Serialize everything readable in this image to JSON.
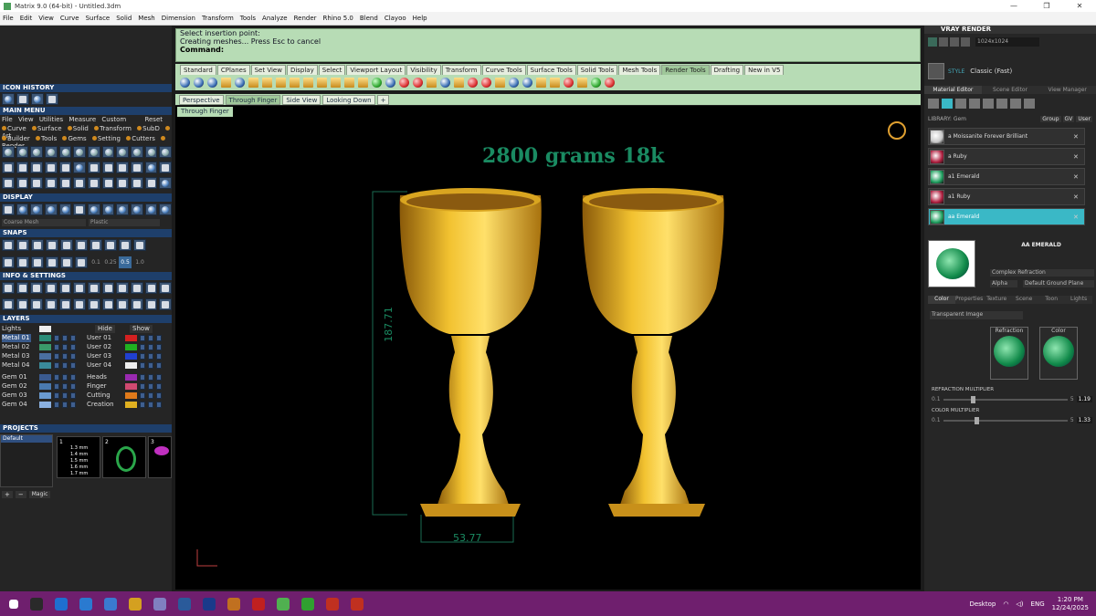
{
  "window": {
    "title": "Matrix 9.0 (64-bit) - Untitled.3dm",
    "minimize": "—",
    "maximize": "❐",
    "close": "✕"
  },
  "menubar": [
    "File",
    "Edit",
    "View",
    "Curve",
    "Surface",
    "Solid",
    "Mesh",
    "Dimension",
    "Transform",
    "Tools",
    "Analyze",
    "Render",
    "Rhino 5.0",
    "Blend",
    "Clayoo",
    "Help"
  ],
  "command": {
    "line1": "Select insertion point:",
    "line2": "Creating meshes... Press Esc to cancel",
    "prompt": "Command:"
  },
  "toolbar_tabs": [
    "Standard",
    "CPlanes",
    "Set View",
    "Display",
    "Select",
    "Viewport Layout",
    "Visibility",
    "Transform",
    "Curve Tools",
    "Surface Tools",
    "Solid Tools",
    "Mesh Tools",
    "Render Tools",
    "Drafting",
    "New in V5"
  ],
  "viewport_tabs": [
    "Perspective",
    "Through Finger",
    "Side View",
    "Looking Down",
    "+"
  ],
  "viewport_label": "Through Finger",
  "viewport": {
    "title": "2800 grams 18k",
    "dim_vertical": "187.71",
    "dim_horizontal": "53.77"
  },
  "left": {
    "icon_history": "ICON HISTORY",
    "main_menu": "MAIN MENU",
    "main_menu_row1": [
      "File",
      "View",
      "Utilities",
      "Measure",
      "Custom",
      "Reset"
    ],
    "main_menu_row2": [
      "Curve",
      "Surface",
      "Solid",
      "Transform",
      "SubD",
      "Art"
    ],
    "main_menu_row3": [
      "Builder",
      "Tools",
      "Gems",
      "Setting",
      "Cutters",
      "Render"
    ],
    "display": "DISPLAY",
    "display_modes": [
      "Coarse Mesh",
      "Plastic"
    ],
    "snaps": "SNAPS",
    "snap_values": [
      "0.1",
      "0.25",
      "0.5",
      "1.0"
    ],
    "info": "INFO & SETTINGS",
    "layers": "LAYERS",
    "lights": "Lights",
    "hide": "Hide",
    "show": "Show",
    "layer_rows": [
      {
        "name": "Metal 01",
        "color": "#2b8c78",
        "name2": "User 01",
        "color2": "#d42020",
        "sel": true
      },
      {
        "name": "Metal 02",
        "color": "#3a9a6a",
        "name2": "User 02",
        "color2": "#20b020"
      },
      {
        "name": "Metal 03",
        "color": "#4a6fa0",
        "name2": "User 03",
        "color2": "#2040d0"
      },
      {
        "name": "Metal 04",
        "color": "#3a8a9a",
        "name2": "User 04",
        "color2": "#eeeeee"
      },
      {
        "name": "Gem 01",
        "color": "#3a5a8f",
        "name2": "Heads",
        "color2": "#9a2ab0"
      },
      {
        "name": "Gem 02",
        "color": "#4a7ab0",
        "name2": "Finger",
        "color2": "#d04a70"
      },
      {
        "name": "Gem 03",
        "color": "#6a9ad0",
        "name2": "Cutting",
        "color2": "#e07a1a"
      },
      {
        "name": "Gem 04",
        "color": "#8ab0e0",
        "name2": "Creation",
        "color2": "#e0b020"
      }
    ],
    "projects": "PROJECTS",
    "project_default": "Default",
    "project_item": "Magic",
    "project_sizes": [
      "1.3 mm",
      "1.4 mm",
      "1.5 mm",
      "1.6 mm",
      "1.7 mm"
    ],
    "thumb_nums": [
      "1",
      "2",
      "3"
    ]
  },
  "right": {
    "title": "VRAY RENDER",
    "resolution": "1024x1024",
    "style_label": "STYLE",
    "style_value": "Classic (Fast)",
    "tabs": [
      "Material Editor",
      "Scene Editor",
      "View Manager"
    ],
    "library": "LIBRARY: Gem",
    "library_btns": [
      "Group",
      "GV",
      "User"
    ],
    "materials": [
      {
        "name": "a Moissanite Forever Brilliant",
        "color": "#c8c8c8"
      },
      {
        "name": "a Ruby",
        "color": "#b02040"
      },
      {
        "name": "a1 Emerald",
        "color": "#20a060"
      },
      {
        "name": "a1 Ruby",
        "color": "#b02040"
      },
      {
        "name": "aa Emerald",
        "color": "#20a060",
        "sel": true
      }
    ],
    "selected_title": "AA EMERALD",
    "refraction_type": "Complex Refraction",
    "alpha": "Alpha",
    "ground": "Default Ground Plane",
    "subtabs": [
      "Color",
      "Properties",
      "Texture",
      "Scene",
      "Toon",
      "Lights"
    ],
    "transparent": "Transparent Image",
    "refraction": "Refraction",
    "color": "Color",
    "refraction_multiplier": "REFRACTION MULTIPLIER",
    "refraction_min": "0.1",
    "refraction_max": "5",
    "refraction_value": "1.19",
    "color_multiplier": "COLOR MULTIPLIER",
    "color_min": "0.1",
    "color_max": "5",
    "color_value": "1.33"
  },
  "taskbar": {
    "desktop": "Desktop",
    "lang": "ENG",
    "time": "1:20 PM",
    "date": "12/24/2025",
    "apps": [
      "#2a2a2a",
      "#1e6fd0",
      "#2a7ad0",
      "#3a7ad0",
      "#d4a020",
      "#8080c0",
      "#2a5a9a",
      "#1a3a8a",
      "#c07020",
      "#c02020",
      "#50b050",
      "#30a030",
      "#c03020",
      "#c03020"
    ]
  }
}
